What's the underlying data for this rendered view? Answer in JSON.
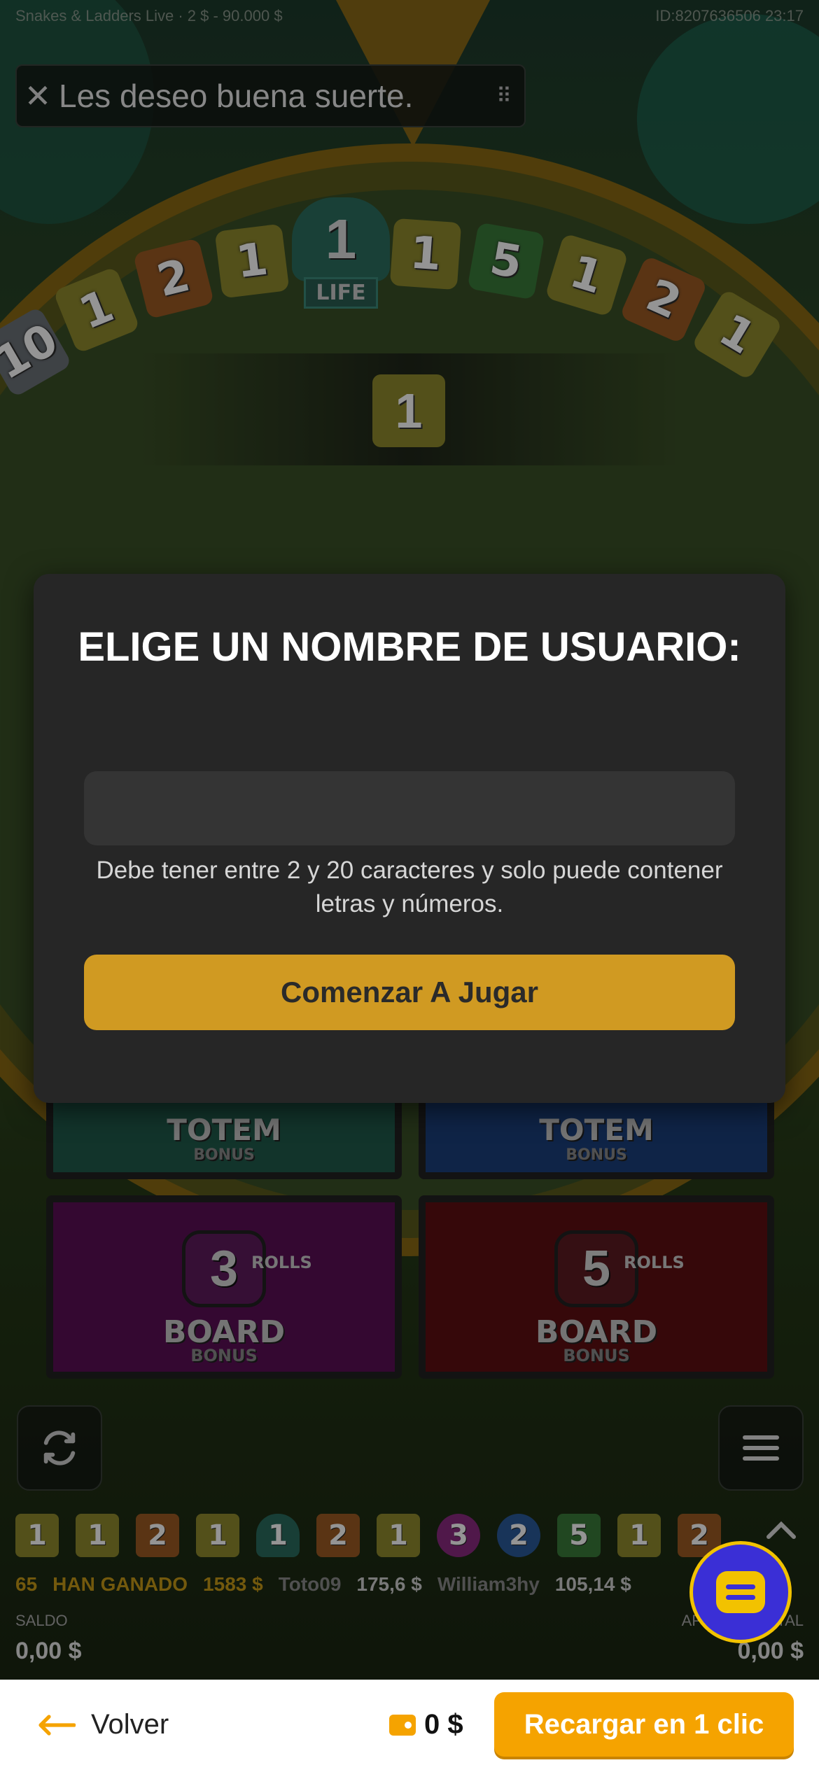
{
  "game": {
    "title_info": "Snakes & Ladders Live · 2 $ - 90.000 $",
    "session_info": "ID:8207636506  23:17",
    "toast_message": "Les deseo buena suerte.",
    "result_value": "1",
    "wheel_segments": [
      "10",
      "1",
      "2",
      "1",
      "1",
      "5",
      "1",
      "2",
      "1"
    ],
    "life_label": "LIFE",
    "life_value": "1",
    "bonus_cards": [
      {
        "label": "TOTEM",
        "sub": "BONUS",
        "color": "#1f5a4a"
      },
      {
        "label": "TOTEM",
        "sub": "BONUS",
        "color": "#1a3f7a"
      },
      {
        "label": "BOARD",
        "sub": "BONUS",
        "rolls": "3",
        "rolls_label": "ROLLS",
        "color": "#5a0f55"
      },
      {
        "label": "BOARD",
        "sub": "BONUS",
        "rolls": "5",
        "rolls_label": "ROLLS",
        "color": "#5e0e12"
      }
    ],
    "history": [
      {
        "v": "1",
        "c": "y"
      },
      {
        "v": "1",
        "c": "y"
      },
      {
        "v": "2",
        "c": "o"
      },
      {
        "v": "1",
        "c": "y"
      },
      {
        "v": "1",
        "c": "t"
      },
      {
        "v": "2",
        "c": "o"
      },
      {
        "v": "1",
        "c": "y"
      },
      {
        "v": "3",
        "c": "p"
      },
      {
        "v": "2",
        "c": "b"
      },
      {
        "v": "5",
        "c": "g"
      },
      {
        "v": "1",
        "c": "y"
      },
      {
        "v": "2",
        "c": "o"
      }
    ],
    "ticker": {
      "winners_count": "65",
      "winners_label": "HAN GANADO",
      "winners_amount": "1583 $",
      "user1": "Toto09",
      "amount1": "175,6 $",
      "user2": "William3hy",
      "amount2": "105,14 $"
    },
    "balance_label": "SALDO",
    "balance_value": "0,00 $",
    "total_bet_label": "APUESTA TOTAL",
    "total_bet_value": "0,00 $"
  },
  "modal": {
    "title": "ELIGE UN NOMBRE DE USUARIO:",
    "input_value": "",
    "hint": "Debe tener entre 2 y 20 caracteres y solo puede contener letras y números.",
    "button_label": "Comenzar A Jugar"
  },
  "bottom_bar": {
    "back_label": "Volver",
    "wallet_amount": "0 $",
    "recharge_label": "Recargar en 1 clic"
  },
  "colors": {
    "accent": "#f5a300",
    "modal_button": "#d09a22",
    "chat_fab": "#3a2fd6"
  }
}
